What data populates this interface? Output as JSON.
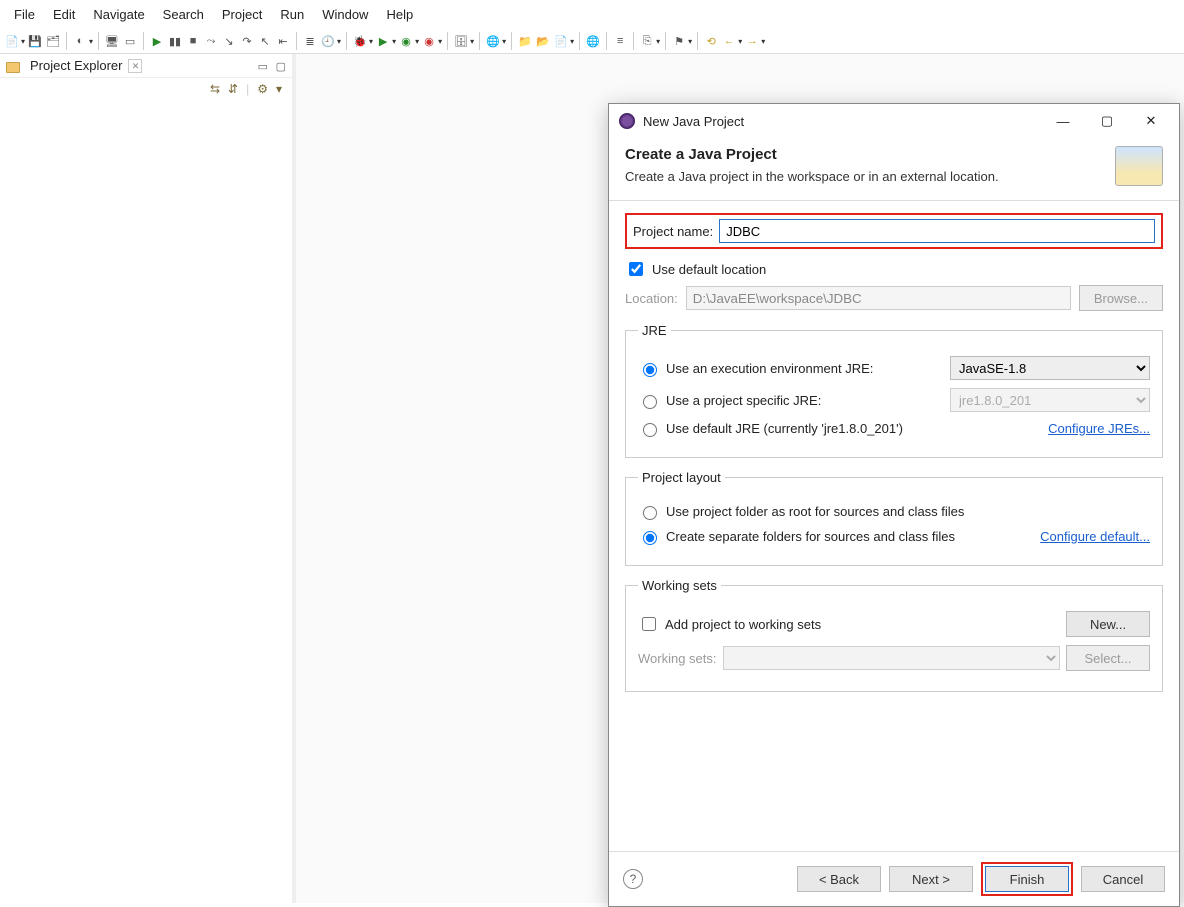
{
  "menu": [
    "File",
    "Edit",
    "Navigate",
    "Search",
    "Project",
    "Run",
    "Window",
    "Help"
  ],
  "view": {
    "title": "Project Explorer",
    "vtIcons": [
      "⇆",
      "⇵",
      "⚙",
      "▾"
    ]
  },
  "dialog": {
    "windowTitle": "New Java Project",
    "heading": "Create a Java Project",
    "sub": "Create a Java project in the workspace or in an external location.",
    "projectNameLabel": "Project name:",
    "projectNameValue": "JDBC",
    "useDefaultLocation": "Use default location",
    "locationLabel": "Location:",
    "locationValue": "D:\\JavaEE\\workspace\\JDBC",
    "browse": "Browse...",
    "jre": {
      "legend": "JRE",
      "opt1": "Use an execution environment JRE:",
      "sel1": "JavaSE-1.8",
      "opt2": "Use a project specific JRE:",
      "sel2": "jre1.8.0_201",
      "opt3": "Use default JRE (currently 'jre1.8.0_201')",
      "link": "Configure JREs..."
    },
    "layout": {
      "legend": "Project layout",
      "opt1": "Use project folder as root for sources and class files",
      "opt2": "Create separate folders for sources and class files",
      "link": "Configure default..."
    },
    "ws": {
      "legend": "Working sets",
      "chk": "Add project to working sets",
      "new": "New...",
      "label": "Working sets:",
      "select": "Select..."
    },
    "buttons": {
      "back": "< Back",
      "next": "Next >",
      "finish": "Finish",
      "cancel": "Cancel"
    }
  }
}
